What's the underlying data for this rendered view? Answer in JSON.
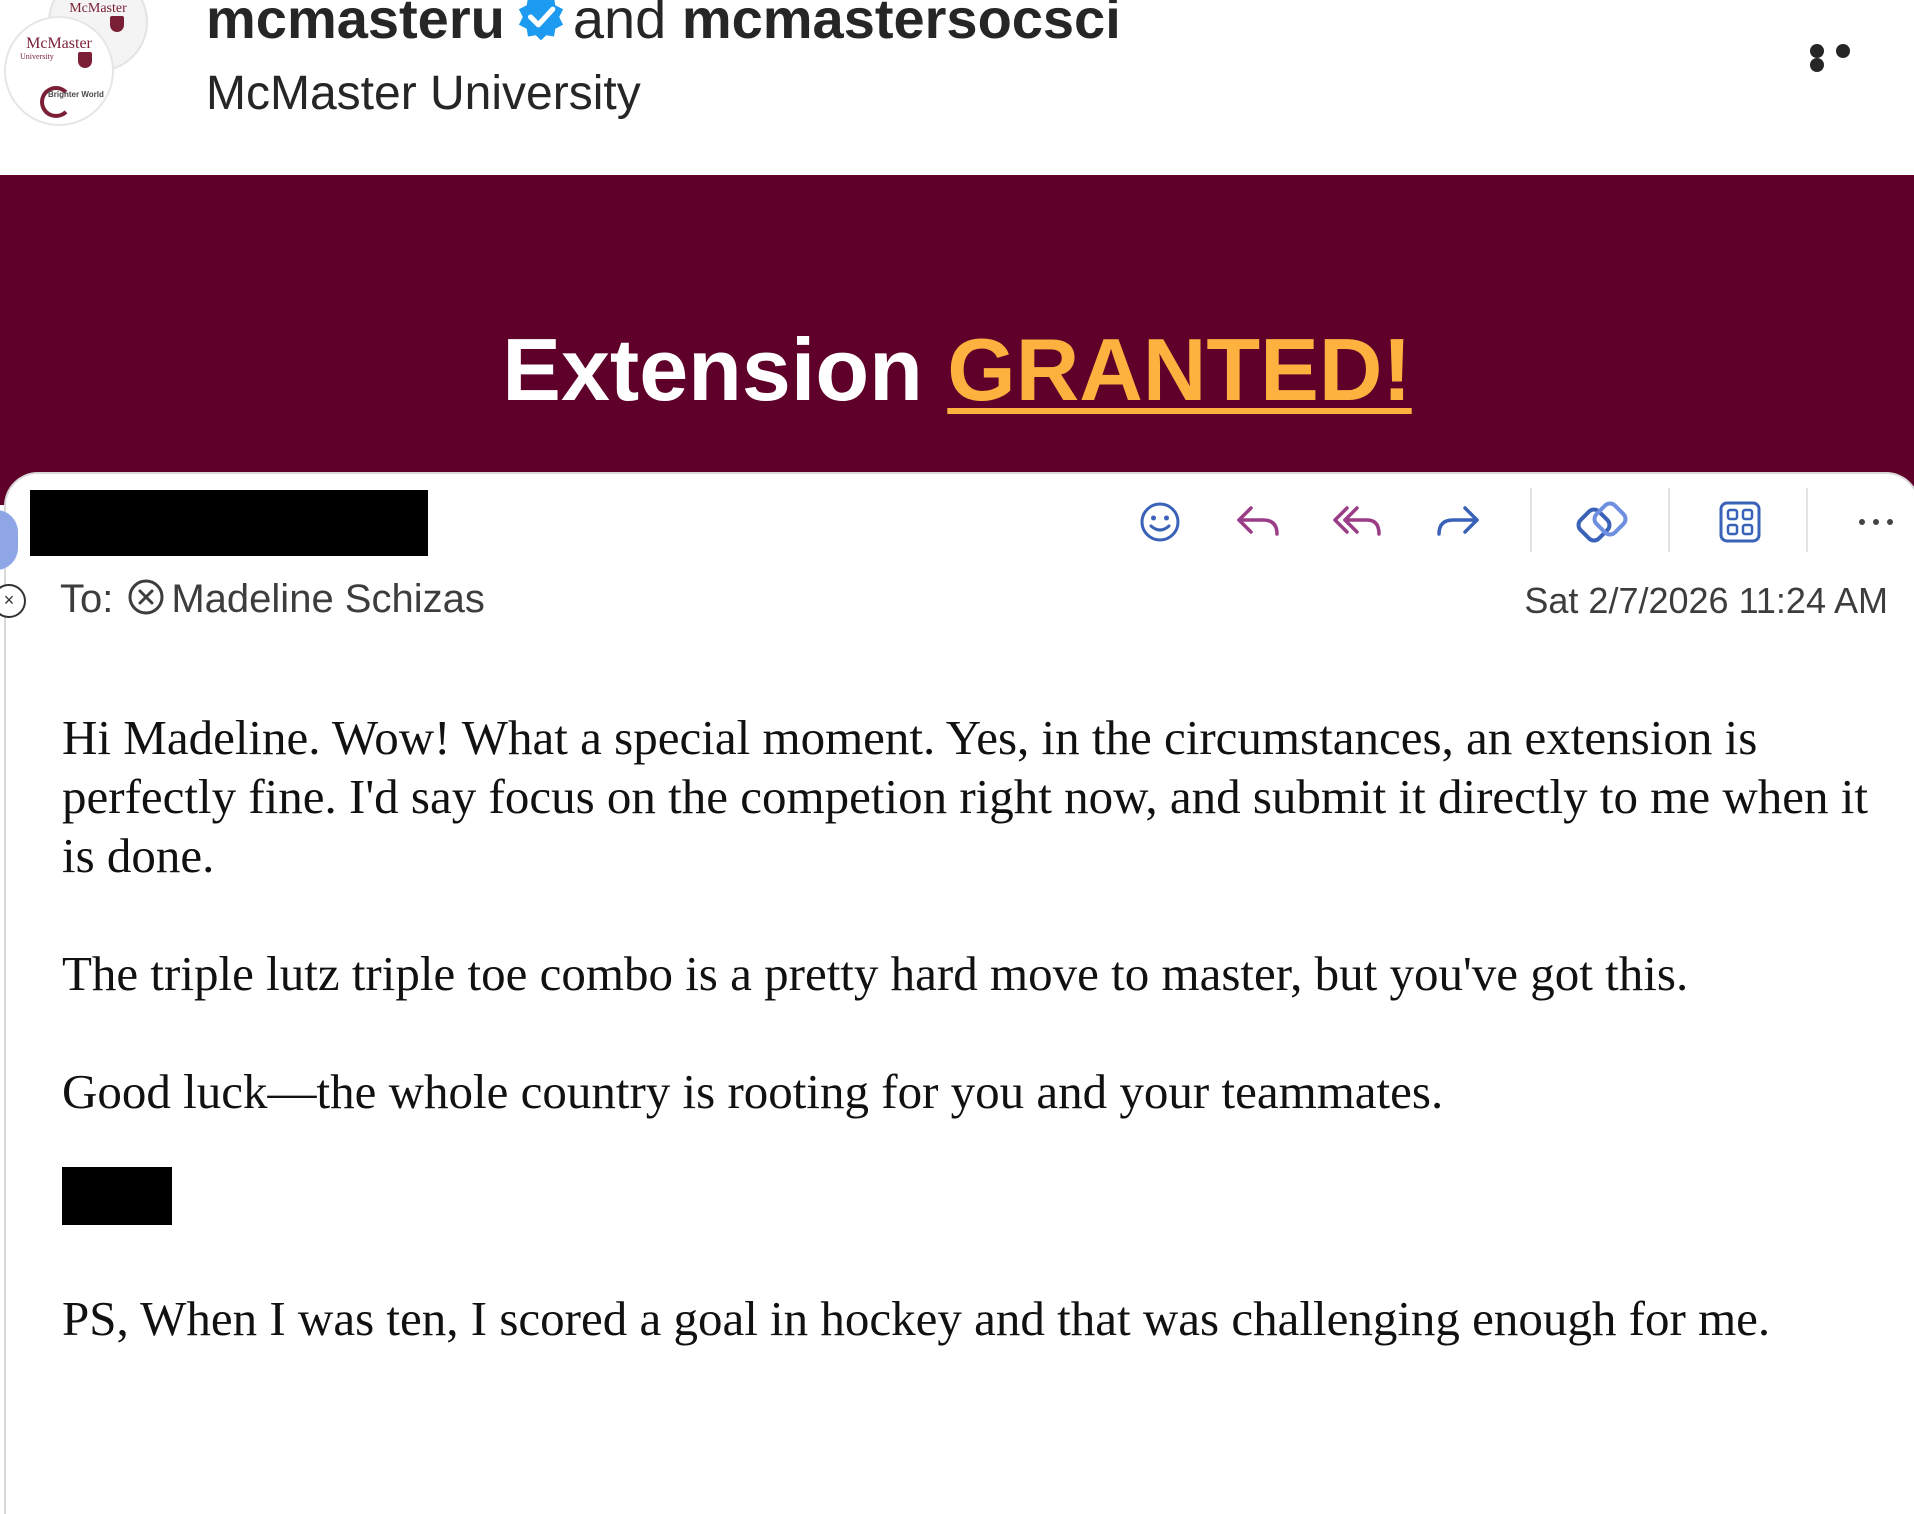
{
  "post": {
    "account_primary": "mcmasteru",
    "conjunction": "and",
    "account_secondary": "mcmastersocsci",
    "subtitle": "McMaster University",
    "avatar_logo_text": "McMaster",
    "avatar_logo_subtext": "University",
    "avatar_tagline": "Brighter World"
  },
  "banner": {
    "headline_plain": "Extension",
    "headline_highlight": "GRANTED!",
    "background_color": "#5f002b",
    "highlight_color": "#fdb13f"
  },
  "email": {
    "to_label": "To:",
    "recipient": "Madeline Schizas",
    "date": "Sat 2/7/2026 11:24 AM",
    "toolbar_icons": [
      "emoji-icon",
      "reply-icon",
      "reply-all-icon",
      "forward-icon",
      "loop-icon",
      "apps-grid-icon",
      "more-icon"
    ],
    "body": {
      "p1": "Hi Madeline.  Wow!  What a special moment.   Yes, in the circumstances, an extension is perfectly fine.  I'd say focus on the competion right now, and submit it directly to me when it is done.",
      "p2": "The triple lutz triple toe combo is a pretty hard move to master, but you've got this.",
      "p3": "Good luck—the whole country is rooting for you and your teammates.",
      "ps": "PS, When I was ten, I scored a goal in hockey and that was challenging enough for me."
    }
  }
}
